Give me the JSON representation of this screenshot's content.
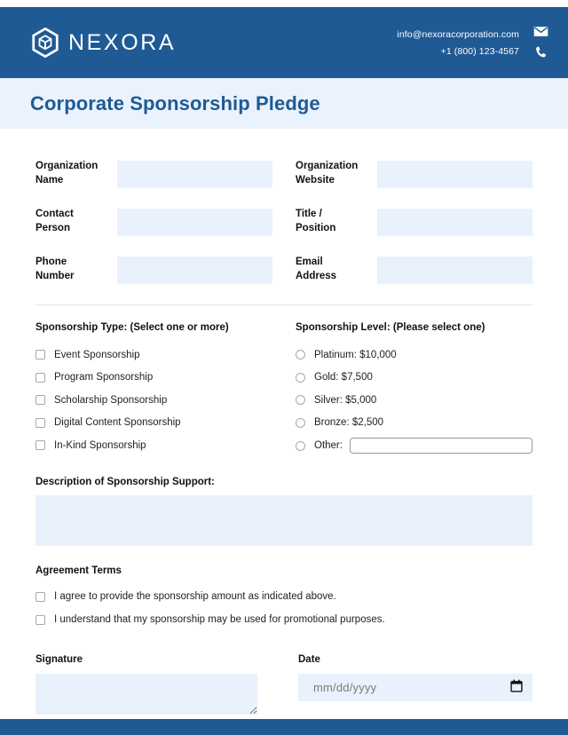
{
  "header": {
    "brand_name": "NEXORA",
    "logo_icon": "hexagon-cube-logo",
    "email": "info@nexoracorporation.com",
    "phone": "+1 (800) 123-4567",
    "email_icon": "envelope-icon",
    "phone_icon": "phone-icon",
    "bg_color": "#1f5a95"
  },
  "title_band": {
    "title": "Corporate Sponsorship Pledge",
    "bg_color": "#eaf2fd",
    "text_color": "#1f5a95"
  },
  "fields": [
    {
      "label": "Organization\nName",
      "value": "",
      "placeholder": ""
    },
    {
      "label": "Organization\nWebsite",
      "value": "",
      "placeholder": ""
    },
    {
      "label": "Contact\nPerson",
      "value": "",
      "placeholder": ""
    },
    {
      "label": "Title /\nPosition",
      "value": "",
      "placeholder": ""
    },
    {
      "label": "Phone\nNumber",
      "value": "",
      "placeholder": ""
    },
    {
      "label": "Email\nAddress",
      "value": "",
      "placeholder": ""
    }
  ],
  "sponsorship_type": {
    "heading": "Sponsorship Type: (Select one or more)",
    "options": [
      {
        "label": "Event Sponsorship",
        "checked": false
      },
      {
        "label": "Program Sponsorship",
        "checked": false
      },
      {
        "label": "Scholarship Sponsorship",
        "checked": false
      },
      {
        "label": "Digital Content Sponsorship",
        "checked": false
      },
      {
        "label": "In-Kind Sponsorship",
        "checked": false
      }
    ]
  },
  "sponsorship_level": {
    "heading": "Sponsorship Level: (Please select one)",
    "options": [
      {
        "label": "Platinum: $10,000",
        "selected": false
      },
      {
        "label": "Gold: $7,500",
        "selected": false
      },
      {
        "label": "Silver: $5,000",
        "selected": false
      },
      {
        "label": "Bronze: $2,500",
        "selected": false
      }
    ],
    "other_label": "Other:",
    "other_value": "",
    "other_placeholder": ""
  },
  "description": {
    "label": "Description of Sponsorship Support:",
    "value": "",
    "placeholder": ""
  },
  "agreement": {
    "heading": "Agreement Terms",
    "items": [
      {
        "label": "I agree to provide the sponsorship amount as indicated above.",
        "checked": false
      },
      {
        "label": "I understand that my sponsorship may be used for promotional purposes.",
        "checked": false
      }
    ]
  },
  "signature": {
    "label": "Signature",
    "value": "",
    "placeholder": ""
  },
  "date": {
    "label": "Date",
    "value": "",
    "placeholder": "mm/dd/yyyy",
    "icon": "calendar-icon"
  },
  "footer": {
    "bg_color": "#1f5a95"
  },
  "input_fill_color": "#e9f1fc"
}
